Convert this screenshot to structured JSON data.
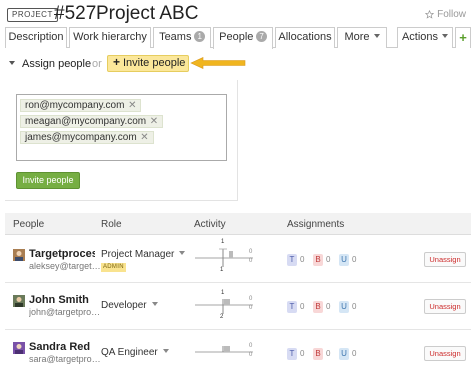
{
  "header": {
    "badge": "PROJECT",
    "id": "#527",
    "name": "Project ABC",
    "follow": "Follow"
  },
  "tabs": {
    "description": "Description",
    "work_hierarchy": "Work hierarchy",
    "teams": "Teams",
    "teams_count": "1",
    "people": "People",
    "people_count": "7",
    "allocations": "Allocations",
    "more": "More",
    "actions": "Actions",
    "add": "+"
  },
  "assign": {
    "label": "Assign people",
    "or": "or",
    "invite": "Invite people"
  },
  "invite_panel": {
    "emails": [
      "ron@mycompany.com",
      "meagan@mycompany.com",
      "james@mycompany.com"
    ],
    "submit": "Invite people"
  },
  "table": {
    "headers": {
      "people": "People",
      "role": "Role",
      "activity": "Activity",
      "assignments": "Assignments"
    },
    "rows": [
      {
        "name": "Targetproces…",
        "email": "aleksey@target…",
        "role": "Project Manager",
        "badge": "ADMIN",
        "activity_top": "1",
        "activity_bottom": "1",
        "activity_right": [
          "0",
          "0"
        ],
        "assignments": [
          {
            "letter": "T",
            "count": "0"
          },
          {
            "letter": "B",
            "count": "0"
          },
          {
            "letter": "U",
            "count": "0"
          }
        ],
        "unassign": "Unassign"
      },
      {
        "name": "John Smith",
        "email": "john@targetpro…",
        "role": "Developer",
        "badge": "",
        "activity_top": "1",
        "activity_bottom": "2",
        "activity_right": [
          "0",
          "0"
        ],
        "assignments": [
          {
            "letter": "T",
            "count": "0"
          },
          {
            "letter": "B",
            "count": "0"
          },
          {
            "letter": "U",
            "count": "0"
          }
        ],
        "unassign": "Unassign"
      },
      {
        "name": "Sandra Red",
        "email": "sara@targetpro…",
        "role": "QA Engineer",
        "badge": "",
        "activity_top": "",
        "activity_bottom": "",
        "activity_right": [
          "0",
          "0"
        ],
        "assignments": [
          {
            "letter": "T",
            "count": "0"
          },
          {
            "letter": "B",
            "count": "0"
          },
          {
            "letter": "U",
            "count": "0"
          }
        ],
        "unassign": "Unassign"
      }
    ]
  },
  "colors": {
    "invite_highlight": "#fbe79a",
    "arrow": "#f0b51f",
    "invite_submit": "#76ae43",
    "badge_t": "#d7dbf3",
    "badge_b": "#f8d7d7",
    "badge_u": "#d5e6f5",
    "unassign_text": "#cc2b2b"
  },
  "icons": {
    "follow": "star-icon",
    "remove_tag": "close-icon",
    "assign_toggle": "caret-down-icon"
  }
}
